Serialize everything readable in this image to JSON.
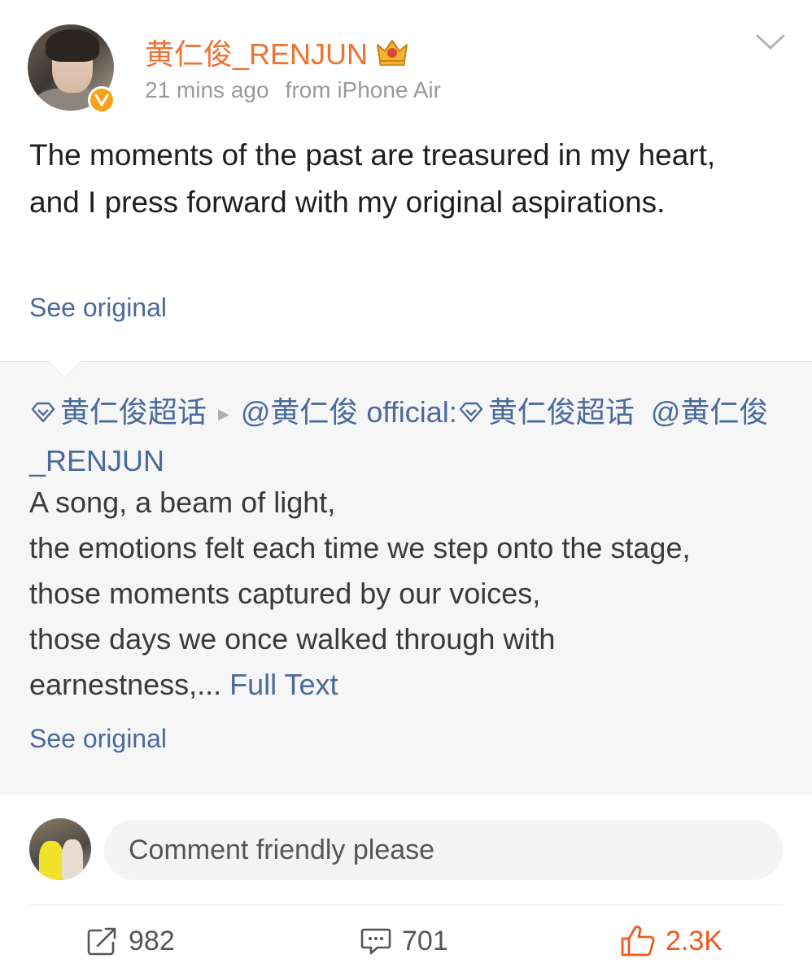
{
  "post": {
    "username": "黄仁俊_RENJUN",
    "time": "21 mins ago",
    "source": "from iPhone Air",
    "text": "The moments of the past are treasured in my heart, and I press forward with my original aspirations.",
    "see_original": "See original"
  },
  "repost": {
    "supertopic_1": "黄仁俊超话",
    "mention_author": "@黄仁俊 official:",
    "supertopic_2": "黄仁俊超话",
    "mention_user": "@黄仁俊_RENJUN",
    "lines": [
      "A song, a beam of light,",
      "the emotions felt each time we step onto the stage,",
      "those moments captured by our voices,",
      "those days we once walked through with",
      "earnestness,..."
    ],
    "full_text": "Full Text",
    "see_original": "See original"
  },
  "comment": {
    "placeholder": "Comment friendly please"
  },
  "actions": {
    "repost_count": "982",
    "comment_count": "701",
    "like_count": "2.3K"
  },
  "colors": {
    "username": "#ee7230",
    "link": "#4a6a9c",
    "like": "#ee5a1f",
    "verified": "#f7a21b"
  }
}
